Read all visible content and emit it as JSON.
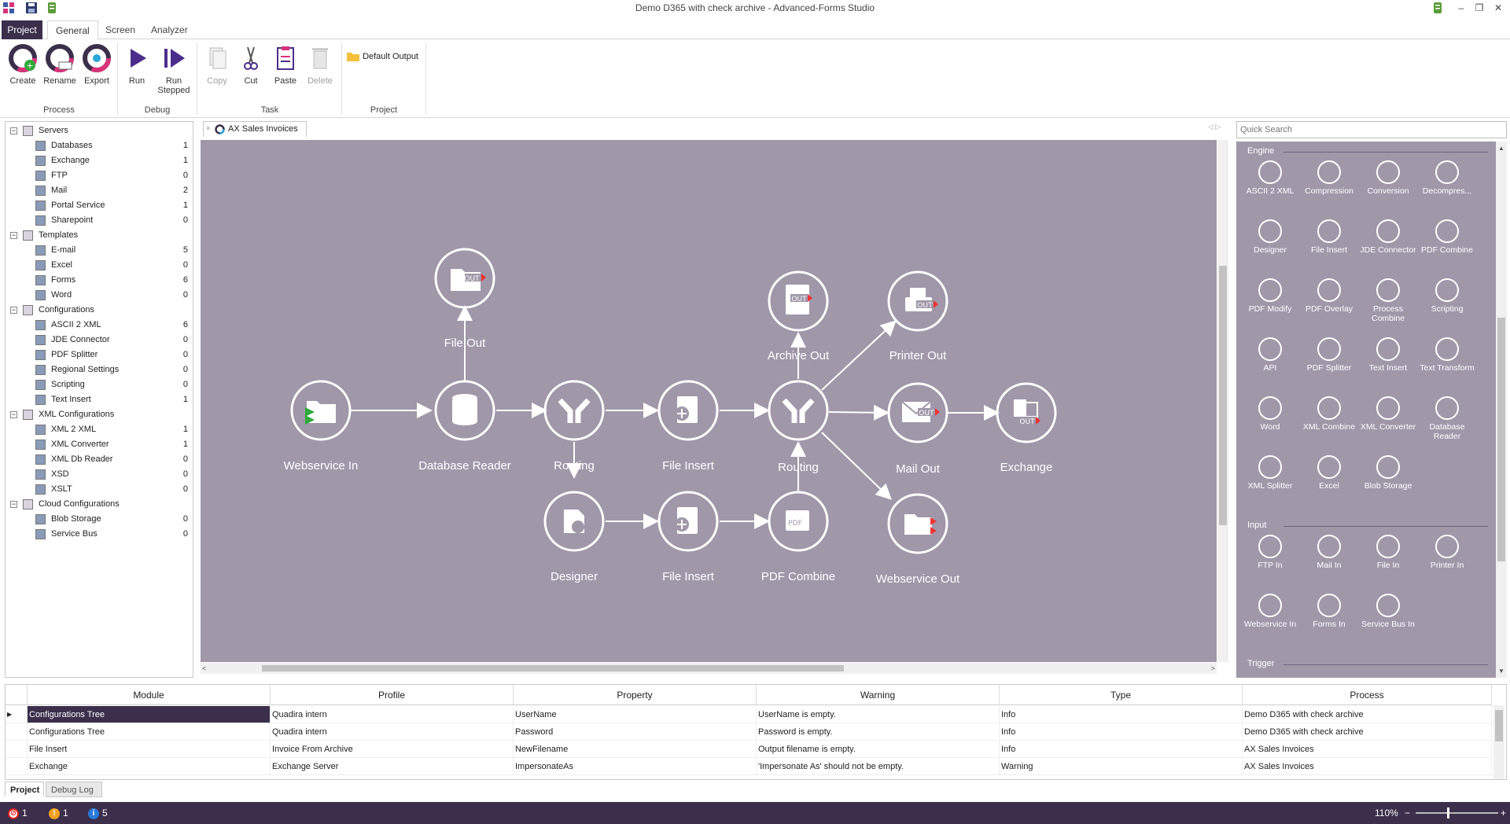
{
  "window": {
    "title": "Demo D365 with check archive - Advanced-Forms Studio"
  },
  "ribbon_tabs": [
    "Project",
    "General",
    "Screen",
    "Analyzer"
  ],
  "ribbon": {
    "groups": [
      {
        "label": "Process",
        "buttons": [
          "Create",
          "Rename",
          "Export"
        ]
      },
      {
        "label": "Debug",
        "buttons": [
          "Run",
          "Run Stepped"
        ]
      },
      {
        "label": "Task",
        "buttons": [
          "Copy",
          "Cut",
          "Paste",
          "Delete"
        ]
      },
      {
        "label": "Project",
        "buttons": [
          "Default Output"
        ]
      }
    ]
  },
  "tree": [
    {
      "label": "Servers",
      "level": 0,
      "count": ""
    },
    {
      "label": "Databases",
      "level": 1,
      "count": "1"
    },
    {
      "label": "Exchange",
      "level": 1,
      "count": "1"
    },
    {
      "label": "FTP",
      "level": 1,
      "count": "0"
    },
    {
      "label": "Mail",
      "level": 1,
      "count": "2"
    },
    {
      "label": "Portal Service",
      "level": 1,
      "count": "1"
    },
    {
      "label": "Sharepoint",
      "level": 1,
      "count": "0"
    },
    {
      "label": "Templates",
      "level": 0,
      "count": ""
    },
    {
      "label": "E-mail",
      "level": 1,
      "count": "5"
    },
    {
      "label": "Excel",
      "level": 1,
      "count": "0"
    },
    {
      "label": "Forms",
      "level": 1,
      "count": "6"
    },
    {
      "label": "Word",
      "level": 1,
      "count": "0"
    },
    {
      "label": "Configurations",
      "level": 0,
      "count": ""
    },
    {
      "label": "ASCII 2 XML",
      "level": 1,
      "count": "6"
    },
    {
      "label": "JDE Connector",
      "level": 1,
      "count": "0"
    },
    {
      "label": "PDF Splitter",
      "level": 1,
      "count": "0"
    },
    {
      "label": "Regional Settings",
      "level": 1,
      "count": "0"
    },
    {
      "label": "Scripting",
      "level": 1,
      "count": "0"
    },
    {
      "label": "Text Insert",
      "level": 1,
      "count": "1"
    },
    {
      "label": "XML Configurations",
      "level": 0,
      "count": ""
    },
    {
      "label": "XML 2 XML",
      "level": 1,
      "count": "1"
    },
    {
      "label": "XML Converter",
      "level": 1,
      "count": "1"
    },
    {
      "label": "XML Db Reader",
      "level": 1,
      "count": "0"
    },
    {
      "label": "XSD",
      "level": 1,
      "count": "0"
    },
    {
      "label": "XSLT",
      "level": 1,
      "count": "0"
    },
    {
      "label": "Cloud Configurations",
      "level": 0,
      "count": ""
    },
    {
      "label": "Blob Storage",
      "level": 1,
      "count": "0"
    },
    {
      "label": "Service Bus",
      "level": 1,
      "count": "0"
    }
  ],
  "document_tab": "AX Sales Invoices",
  "flow_nodes": [
    {
      "label": "Webservice In",
      "icon": "folder-in-icon"
    },
    {
      "label": "Database Reader",
      "icon": "database-icon"
    },
    {
      "label": "File Out",
      "icon": "folder-out-icon"
    },
    {
      "label": "Routing",
      "icon": "routing-icon"
    },
    {
      "label": "File Insert",
      "icon": "file-insert-icon"
    },
    {
      "label": "Routing",
      "icon": "routing-icon"
    },
    {
      "label": "Archive Out",
      "icon": "archive-out-icon"
    },
    {
      "label": "Printer Out",
      "icon": "printer-out-icon"
    },
    {
      "label": "Mail Out",
      "icon": "mail-out-icon"
    },
    {
      "label": "Exchange",
      "icon": "exchange-icon"
    },
    {
      "label": "Webservice Out",
      "icon": "folder-out-icon"
    },
    {
      "label": "Designer",
      "icon": "designer-icon"
    },
    {
      "label": "File Insert",
      "icon": "file-insert-icon"
    },
    {
      "label": "PDF Combine",
      "icon": "pdf-combine-icon"
    }
  ],
  "quick_search": {
    "placeholder": "Quick Search"
  },
  "toolbox": {
    "sections": [
      {
        "title": "Engine",
        "items": [
          "ASCII 2 XML",
          "Compression",
          "Conversion",
          "Decompres...",
          "Designer",
          "File Insert",
          "JDE Connector",
          "PDF Combine",
          "PDF Modify",
          "PDF Overlay",
          "Process Combine",
          "Scripting",
          "API",
          "PDF Splitter",
          "Text Insert",
          "Text Transform",
          "Word",
          "XML Combine",
          "XML Converter",
          "Database Reader",
          "XML Splitter",
          "Excel",
          "Blob Storage"
        ]
      },
      {
        "title": "Input",
        "items": [
          "FTP In",
          "Mail In",
          "File In",
          "Printer In",
          "Webservice In",
          "Forms In",
          "Service Bus In"
        ]
      },
      {
        "title": "Trigger",
        "items": []
      }
    ]
  },
  "grid": {
    "columns": [
      "Module",
      "Profile",
      "Property",
      "Warning",
      "Type",
      "Process"
    ],
    "rows": [
      [
        "Configurations Tree",
        "Quadira intern",
        "UserName",
        "UserName is empty.",
        "Info",
        "Demo D365 with check archive"
      ],
      [
        "Configurations Tree",
        "Quadira intern",
        "Password",
        "Password is empty.",
        "Info",
        "Demo D365 with check archive"
      ],
      [
        "File Insert",
        "Invoice From Archive",
        "NewFilename",
        "Output filename is empty.",
        "Info",
        "AX Sales Invoices"
      ],
      [
        "Exchange",
        "Exchange Server",
        "ImpersonateAs",
        "'Impersonate As' should not be empty.",
        "Warning",
        "AX Sales Invoices"
      ]
    ]
  },
  "bottom_tabs": [
    "Project",
    "Debug Log"
  ],
  "status": {
    "errors": "1",
    "warnings": "1",
    "infos": "5",
    "zoom": "110%",
    "zoom_minus": "−",
    "zoom_plus": "+"
  },
  "colors": {
    "accent": "#3b2f4b",
    "canvas": "#a097a9"
  }
}
